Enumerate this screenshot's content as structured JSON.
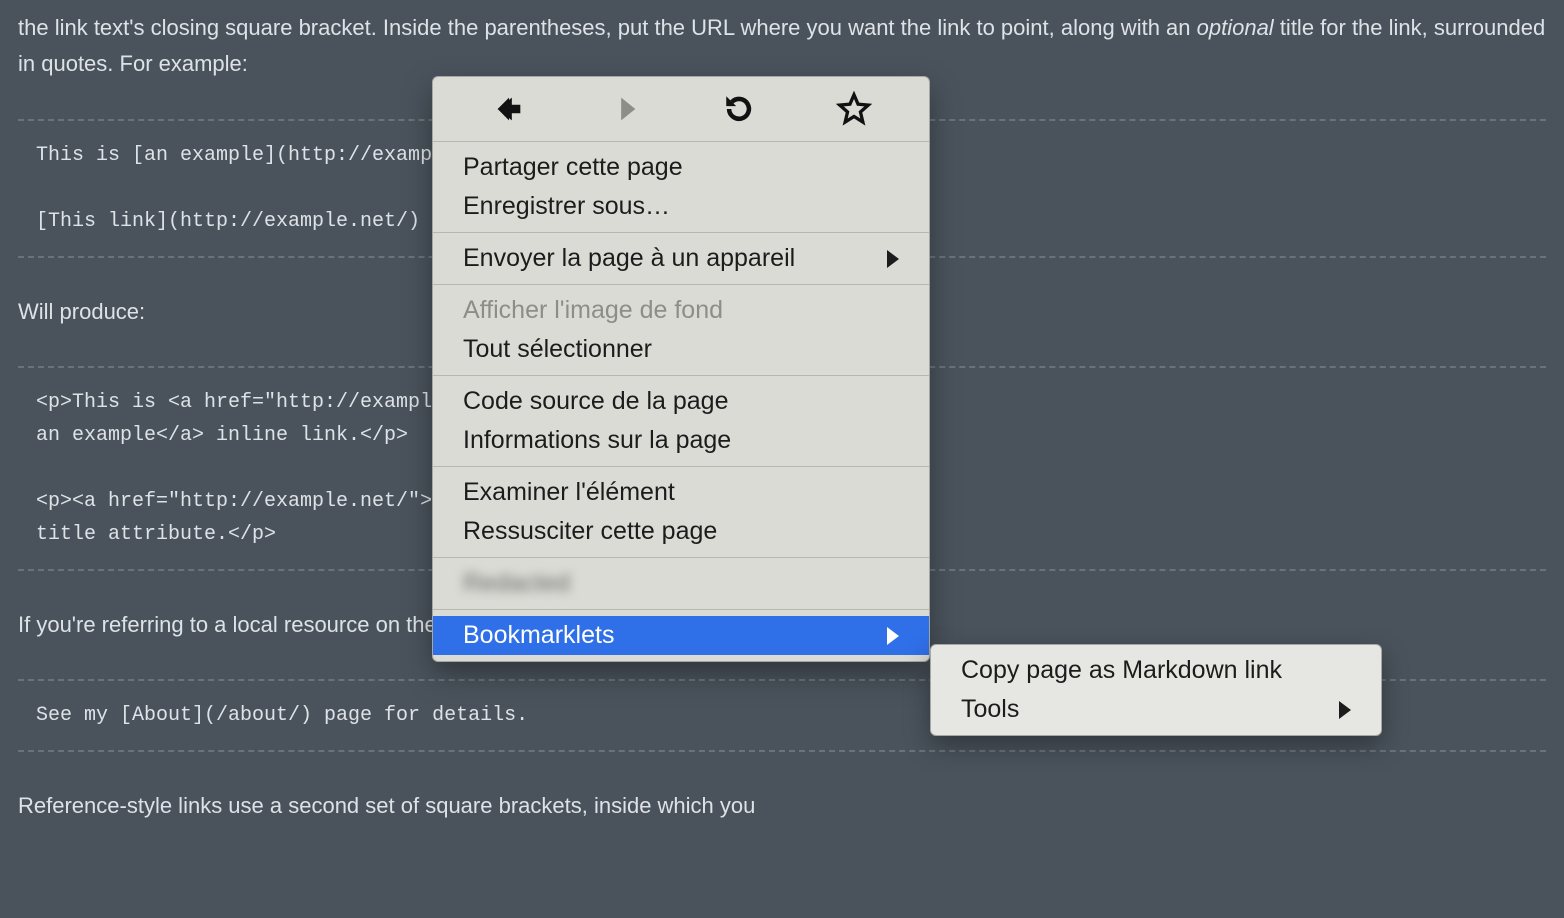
{
  "page": {
    "p1_a": "the link text's closing square bracket. Inside the parentheses, put the URL where you want the link to point, along with an ",
    "p1_em": "optional",
    "p1_b": " title for the link, surrounded in quotes. For example:",
    "code1": "This is [an example](http://example.com/ \"Title\") inline link.\n\n[This link](http://example.net/) has no title attribute.",
    "p2": "Will produce:",
    "code2": "<p>This is <a href=\"http://example.com/\" title=\"Title\">\nan example</a> inline link.</p>\n\n<p><a href=\"http://example.net/\">This link</a> has no\ntitle attribute.</p>",
    "p3": "If you're referring to a local resource on the same server, you can use relative paths:",
    "code3": "See my [About](/about/) page for details.",
    "p4": "Reference-style links use a second set of square brackets, inside which you"
  },
  "contextMenu": {
    "toolbar": {
      "back": "back-arrow",
      "forward": "forward-arrow",
      "reload": "reload",
      "bookmark": "star"
    },
    "groups": [
      {
        "items": [
          {
            "label": "Partager cette page",
            "chev": false,
            "disabled": false
          },
          {
            "label": "Enregistrer sous…",
            "chev": false,
            "disabled": false
          }
        ]
      },
      {
        "items": [
          {
            "label": "Envoyer la page à un appareil",
            "chev": true,
            "disabled": false
          }
        ]
      },
      {
        "items": [
          {
            "label": "Afficher l'image de fond",
            "chev": false,
            "disabled": true
          },
          {
            "label": "Tout sélectionner",
            "chev": false,
            "disabled": false
          }
        ]
      },
      {
        "items": [
          {
            "label": "Code source de la page",
            "chev": false,
            "disabled": false
          },
          {
            "label": "Informations sur la page",
            "chev": false,
            "disabled": false
          }
        ]
      },
      {
        "items": [
          {
            "label": "Examiner l'élément",
            "chev": false,
            "disabled": false
          },
          {
            "label": "Ressusciter cette page",
            "chev": false,
            "disabled": false
          }
        ]
      },
      {
        "items": [
          {
            "label": "Redacted",
            "chev": false,
            "disabled": false,
            "blurred": true
          }
        ]
      },
      {
        "items": [
          {
            "label": "Bookmarklets",
            "chev": true,
            "disabled": false,
            "selected": true
          }
        ]
      }
    ]
  },
  "submenu": {
    "items": [
      {
        "label": "Copy page as Markdown link",
        "chev": false
      },
      {
        "label": "Tools",
        "chev": true
      }
    ]
  }
}
